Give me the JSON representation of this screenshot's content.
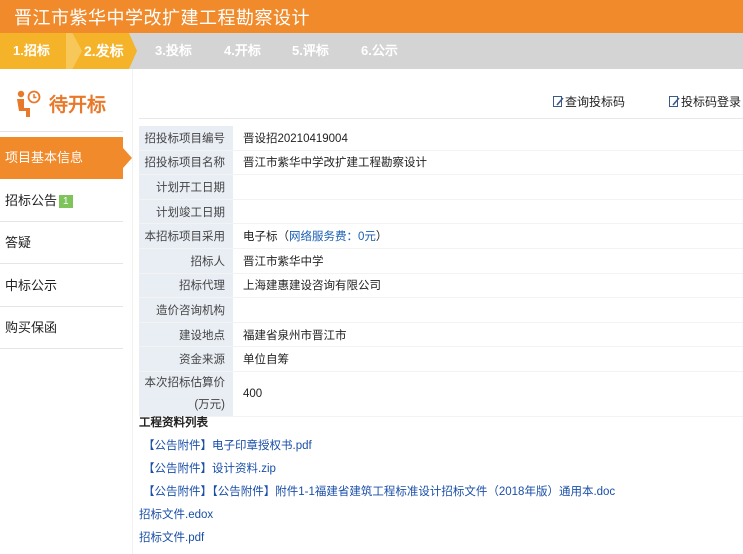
{
  "header": {
    "title": "晋江市紫华中学改扩建工程勘察设计"
  },
  "steps": [
    {
      "label": "1.招标"
    },
    {
      "label": "2.发标"
    },
    {
      "label": "3.投标"
    },
    {
      "label": "4.开标"
    },
    {
      "label": "5.评标"
    },
    {
      "label": "6.公示"
    }
  ],
  "sidebar": {
    "status": "待开标",
    "items": [
      {
        "label": "项目基本信息"
      },
      {
        "label": "招标公告",
        "badge": "1"
      },
      {
        "label": "答疑"
      },
      {
        "label": "中标公示"
      },
      {
        "label": "购买保函"
      }
    ]
  },
  "actions": {
    "query_code": "查询投标码",
    "code_login": "投标码登录"
  },
  "info": [
    {
      "label": "招投标项目编号",
      "value": "晋设招20210419004"
    },
    {
      "label": "招投标项目名称",
      "value": "晋江市紫华中学改扩建工程勘察设计"
    },
    {
      "label": "计划开工日期",
      "value": ""
    },
    {
      "label": "计划竣工日期",
      "value": ""
    },
    {
      "label": "本招标项目采用",
      "value": "电子标（",
      "value_link": "网络服务费：0元",
      "value_tail": "）"
    },
    {
      "label": "招标人",
      "value": "晋江市紫华中学"
    },
    {
      "label": "招标代理",
      "value": "上海建惠建设咨询有限公司"
    },
    {
      "label": "造价咨询机构",
      "value": ""
    },
    {
      "label": "建设地点",
      "value": "福建省泉州市晋江市"
    },
    {
      "label": "资金来源",
      "value": "单位自筹"
    },
    {
      "label": "本次招标估算价",
      "label2": "(万元)",
      "value": "400"
    }
  ],
  "files": {
    "title": "工程资料列表",
    "items": [
      "【公告附件】电子印章授权书.pdf",
      "【公告附件】设计资料.zip",
      "【公告附件】【公告附件】附件1-1福建省建筑工程标准设计招标文件（2018年版）通用本.doc",
      "招标文件.edox",
      "招标文件.pdf"
    ]
  },
  "colors": {
    "brand_orange": "#f08a2a",
    "step_active": "#f4b328",
    "label_bg": "#e9eef5",
    "link_blue": "#1a4fa8"
  }
}
